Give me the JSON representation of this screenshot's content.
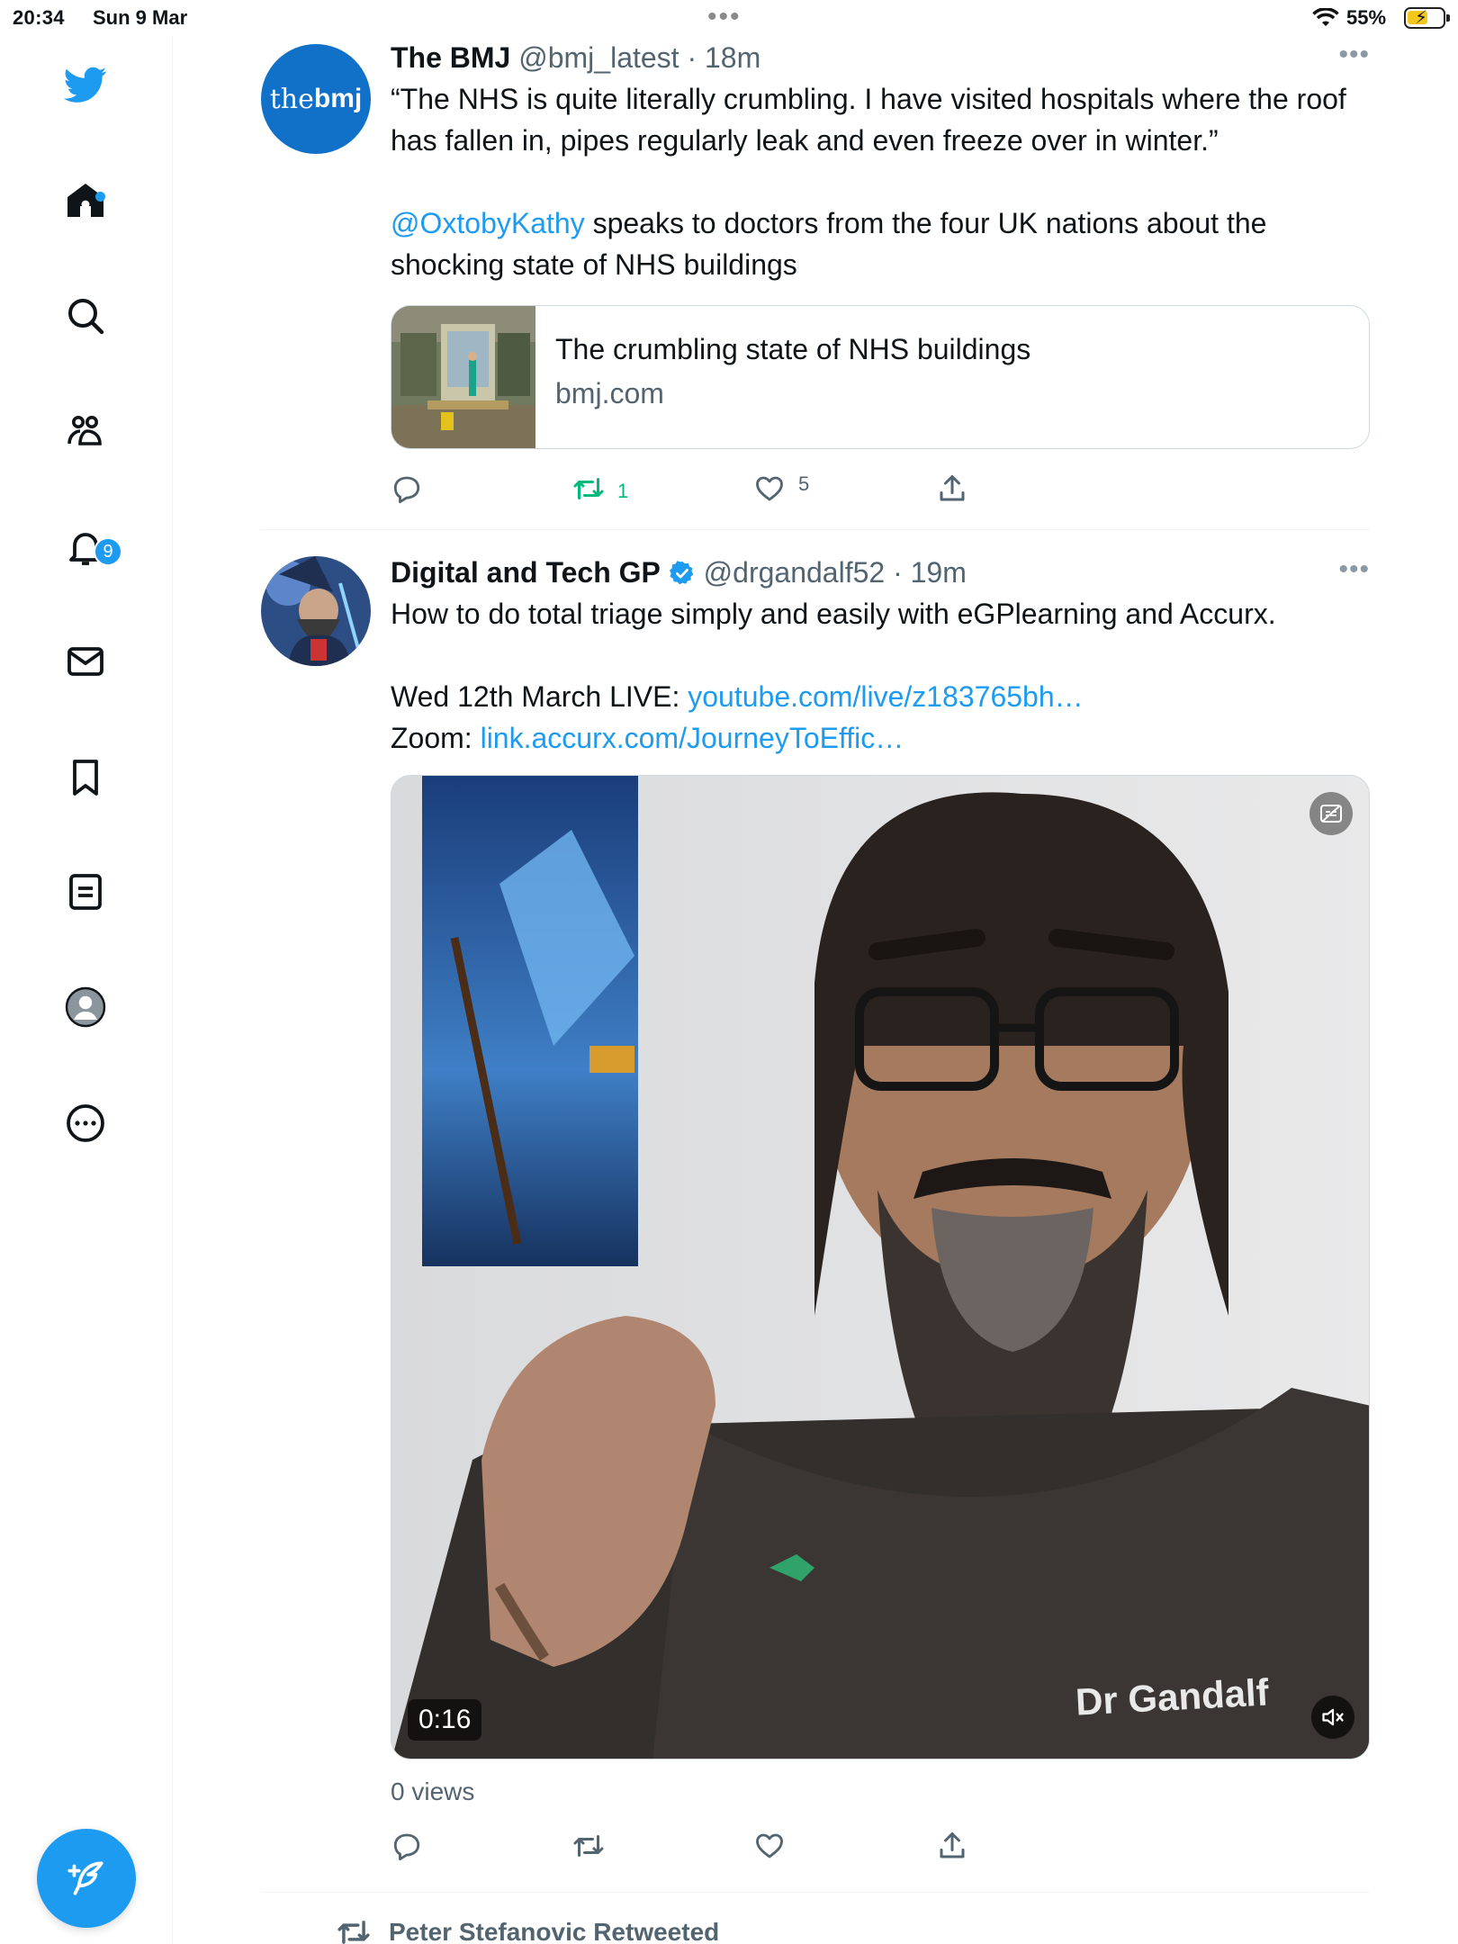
{
  "status_bar": {
    "time": "20:34",
    "date": "Sun 9 Mar",
    "battery": "55%"
  },
  "sidebar": {
    "items": [
      {
        "icon": "twitter-bird-icon"
      },
      {
        "icon": "home-icon"
      },
      {
        "icon": "search-icon"
      },
      {
        "icon": "communities-icon"
      },
      {
        "icon": "notifications-icon",
        "badge": "9"
      },
      {
        "icon": "messages-icon"
      },
      {
        "icon": "bookmarks-icon"
      },
      {
        "icon": "lists-icon"
      },
      {
        "icon": "profile-icon"
      },
      {
        "icon": "more-icon"
      }
    ],
    "compose_icon": "compose-tweet-icon"
  },
  "tweets": [
    {
      "avatar_text_a": "the",
      "avatar_text_b": "bmj",
      "name": "The BMJ",
      "handle": "@bmj_latest",
      "sep": " · ",
      "time": "18m",
      "text1": "“The NHS is quite literally crumbling. I have visited hospitals where the roof has fallen in, pipes regularly leak and even freeze over in winter.”",
      "mention": "@OxtobyKathy",
      "text2": " speaks to doctors from the four UK nations about the shocking state of NHS buildings",
      "card": {
        "title": "The crumbling state of NHS buildings",
        "domain": "bmj.com"
      },
      "retweets": "1",
      "likes": "5"
    },
    {
      "name": "Digital and Tech GP",
      "handle": "@drgandalf52",
      "sep": " · ",
      "time": "19m",
      "text1": "How to do total triage simply and easily with eGPlearning and Accurx.",
      "line2_prefix": "Wed 12th March LIVE: ",
      "line2_link": "youtube.com/live/z183765bh…",
      "line3_prefix": "Zoom: ",
      "line3_link": "link.accurx.com/JourneyToEffic…",
      "video": {
        "duration": "0:16",
        "overlay_text": "Dr Gandalf"
      },
      "views": "0 views"
    }
  ],
  "next": {
    "retweeted_by": "Peter Stefanovic Retweeted"
  },
  "colors": {
    "accent": "#1d9bf0",
    "retweet_green": "#00ba7c",
    "secondary_text": "#536471"
  }
}
